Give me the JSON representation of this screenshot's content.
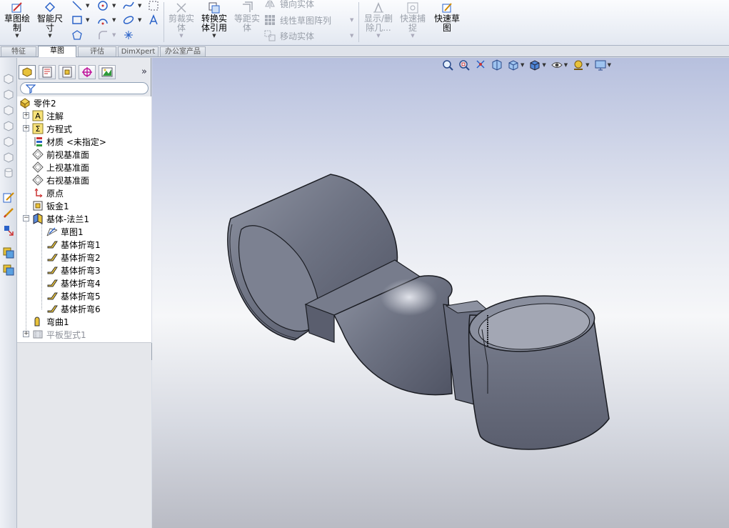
{
  "ribbon": {
    "sketch": "草图绘\n制",
    "smart_dim": "智能尺\n寸",
    "trim": "剪裁实\n体",
    "convert": "转换实\n体引用",
    "offset": "等距实\n体",
    "mirror": "镜向实体",
    "linear_pattern": "线性草图阵列",
    "move": "移动实体",
    "show_delete": "显示/删\n除几...",
    "quick_snap": "快速捕\n捉",
    "rapid_sketch": "快速草\n图"
  },
  "tabs": [
    "特征",
    "草图",
    "评估",
    "DimXpert",
    "办公室产品"
  ],
  "active_tab": "草图",
  "tree": {
    "root": "零件2",
    "annotations": "注解",
    "equations": "方程式",
    "material": "材质 <未指定>",
    "front_plane": "前视基准面",
    "top_plane": "上视基准面",
    "right_plane": "右视基准面",
    "origin": "原点",
    "sheet_metal": "钣金1",
    "base_flange": "基体-法兰1",
    "sketch": "草图1",
    "bends": [
      "基体折弯1",
      "基体折弯2",
      "基体折弯3",
      "基体折弯4",
      "基体折弯5",
      "基体折弯6"
    ],
    "bend": "弯曲1",
    "flat_pattern": "平板型式1"
  },
  "colors": {
    "accent": "#2a62c8",
    "model": "#6e7383",
    "tab_active": "#ffffff"
  }
}
